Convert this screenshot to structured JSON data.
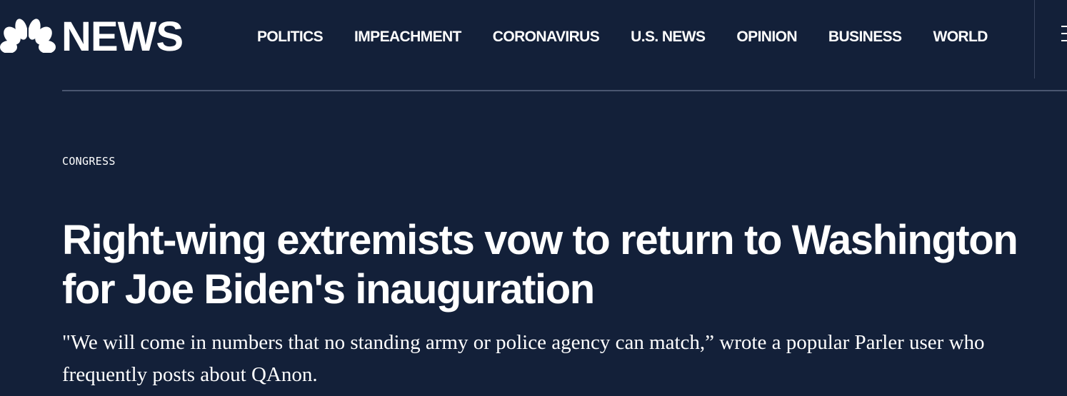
{
  "brand": {
    "logo_text": "NEWS",
    "logo_icon": "nbc-peacock-icon"
  },
  "nav": {
    "items": [
      {
        "label": "POLITICS"
      },
      {
        "label": "IMPEACHMENT"
      },
      {
        "label": "CORONAVIRUS"
      },
      {
        "label": "U.S. NEWS"
      },
      {
        "label": "OPINION"
      },
      {
        "label": "BUSINESS"
      },
      {
        "label": "WORLD"
      }
    ],
    "menu_icon": "hamburger-menu-icon"
  },
  "article": {
    "eyebrow": "CONGRESS",
    "headline": "Right-wing extremists vow to return to Washington for Joe Biden's inauguration",
    "dek": "\"We will come in numbers that no standing army or police agency can match,” wrote a popular Parler user who frequently posts about QAnon."
  },
  "colors": {
    "background": "#132039",
    "text": "#ffffff"
  }
}
